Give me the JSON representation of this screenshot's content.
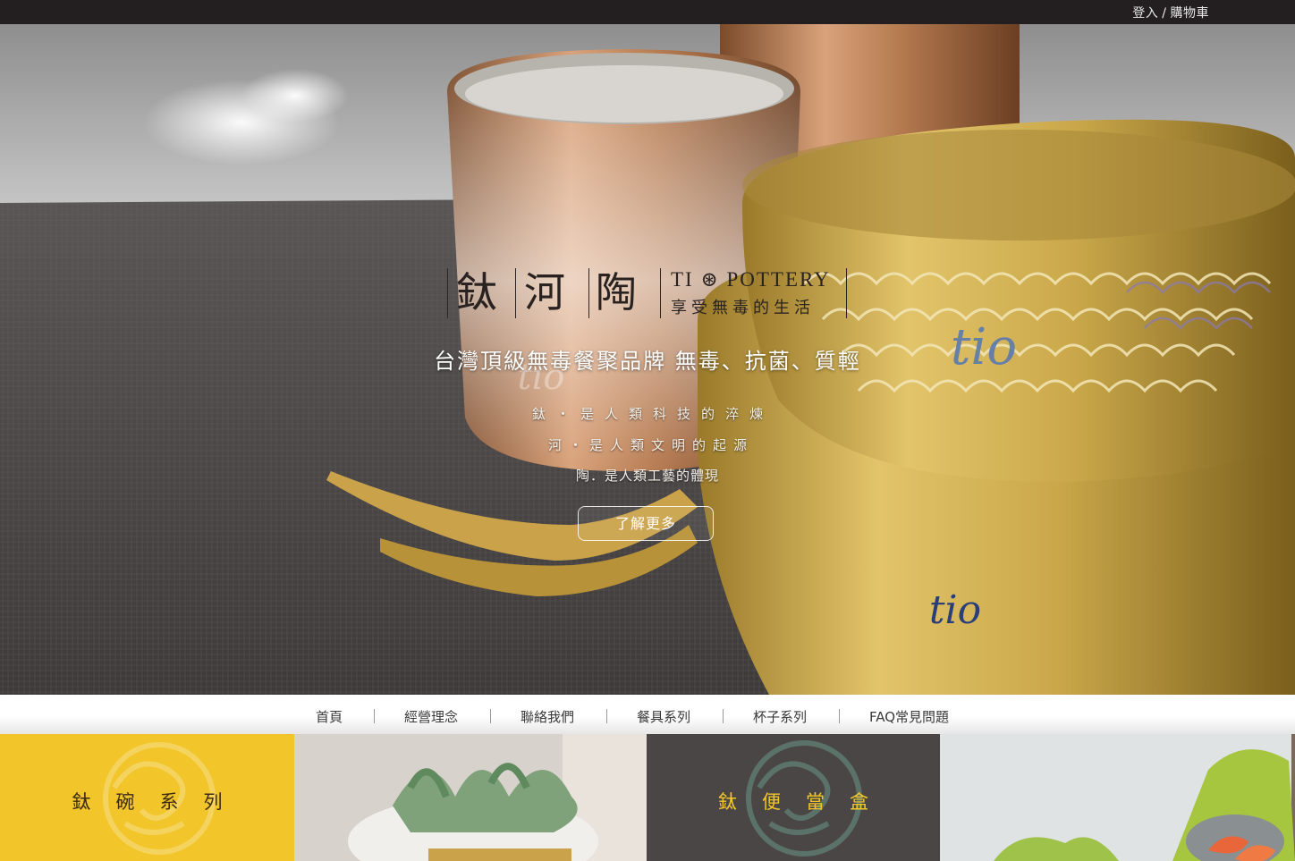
{
  "topbar": {
    "login": "登入",
    "separator": "/",
    "cart": "購物車"
  },
  "hero": {
    "brand_chars": [
      "鈦",
      "河",
      "陶"
    ],
    "brand_en": "TI ⊛ POTTERY",
    "brand_sub": "享受無毒的生活",
    "slogan": "台灣頂級無毒餐聚品牌  無毒、抗菌、質輕",
    "line1": "鈦・是人類科技的淬煉",
    "line2": "河・是人類文明的起源",
    "line3": "陶．是人類工藝的體現",
    "cta": "了解更多",
    "product_mark": "tio"
  },
  "nav": {
    "items": [
      "首頁",
      "經營理念",
      "聯絡我們",
      "餐具系列",
      "杯子系列",
      "FAQ常見問題"
    ]
  },
  "tiles": {
    "bowl_series": "鈦碗系列",
    "bento_box": "鈦便當盒"
  },
  "colors": {
    "topbar": "#231f20",
    "accent_yellow": "#f2c52a",
    "dark_tile": "#4a4645",
    "text_dark": "#2a2220"
  }
}
